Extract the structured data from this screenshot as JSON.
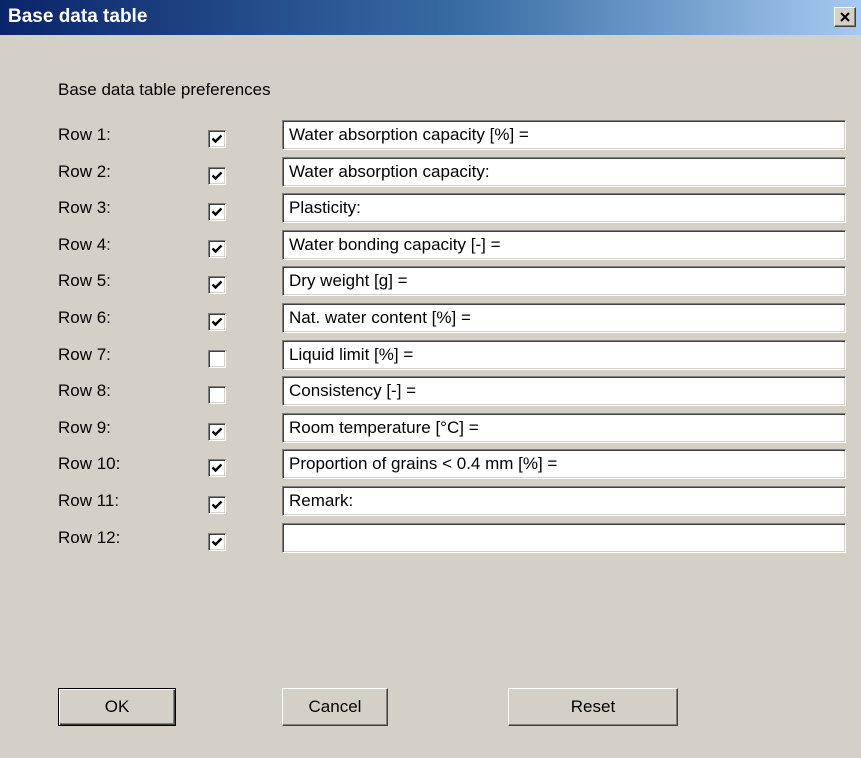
{
  "window": {
    "title": "Base data table"
  },
  "group": {
    "caption": "Base data table preferences"
  },
  "rows": [
    {
      "label": "Row 1:",
      "checked": true,
      "value": "Water absorption capacity [%] ="
    },
    {
      "label": "Row 2:",
      "checked": true,
      "value": "Water absorption capacity:"
    },
    {
      "label": "Row 3:",
      "checked": true,
      "value": "Plasticity:"
    },
    {
      "label": "Row 4:",
      "checked": true,
      "value": "Water bonding capacity [-] ="
    },
    {
      "label": "Row 5:",
      "checked": true,
      "value": "Dry weight [g] ="
    },
    {
      "label": "Row 6:",
      "checked": true,
      "value": "Nat. water content [%] ="
    },
    {
      "label": "Row 7:",
      "checked": false,
      "value": "Liquid limit [%] ="
    },
    {
      "label": "Row 8:",
      "checked": false,
      "value": "Consistency [-] ="
    },
    {
      "label": "Row 9:",
      "checked": true,
      "value": "Room temperature [°C] ="
    },
    {
      "label": "Row 10:",
      "checked": true,
      "value": "Proportion of grains < 0.4 mm [%] ="
    },
    {
      "label": "Row 11:",
      "checked": true,
      "value": "Remark:"
    },
    {
      "label": "Row 12:",
      "checked": true,
      "value": ""
    }
  ],
  "buttons": {
    "ok": "OK",
    "cancel": "Cancel",
    "reset": "Reset"
  },
  "colors": {
    "titlebar_start": "#0a246a",
    "titlebar_end": "#a6caf0",
    "face": "#d4d0c8"
  }
}
